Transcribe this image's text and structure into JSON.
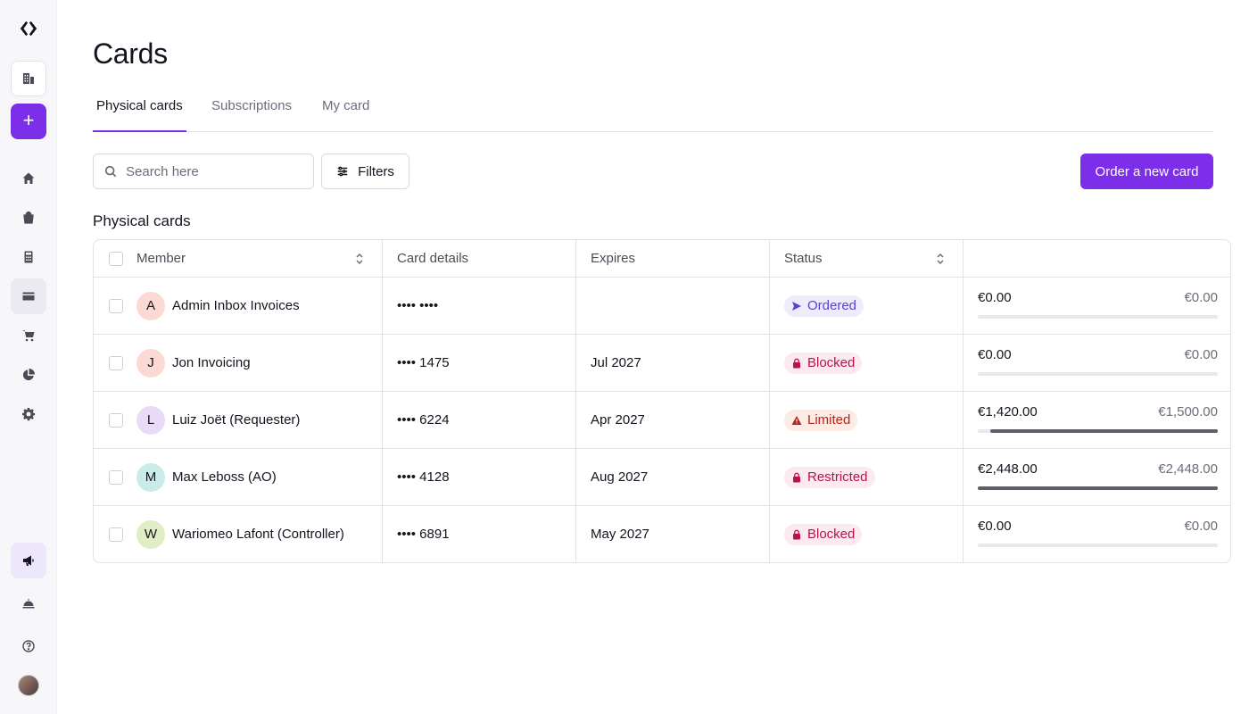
{
  "page": {
    "title": "Cards"
  },
  "tabs": [
    {
      "label": "Physical cards",
      "active": true
    },
    {
      "label": "Subscriptions",
      "active": false
    },
    {
      "label": "My card",
      "active": false
    }
  ],
  "toolbar": {
    "search_placeholder": "Search here",
    "filters_label": "Filters",
    "order_label": "Order a new card"
  },
  "section_title": "Physical cards",
  "table": {
    "columns": {
      "member": "Member",
      "card": "Card details",
      "expires": "Expires",
      "status": "Status"
    },
    "rows": [
      {
        "initial": "A",
        "avatar_bg": "#fcd9d3",
        "member": "Admin Inbox Invoices",
        "card": "•••• ••••",
        "expires": "",
        "status": "Ordered",
        "status_icon": "send-icon",
        "status_color": "#5b3fd1",
        "status_bg": "#eeebfb",
        "spent": "€0.00",
        "limit": "€0.00",
        "fraction": 0
      },
      {
        "initial": "J",
        "avatar_bg": "#fcd9d3",
        "member": "Jon Invoicing",
        "card": "•••• 1475",
        "expires": "Jul 2027",
        "status": "Blocked",
        "status_icon": "lock-icon",
        "status_color": "#b8124f",
        "status_bg": "#fbeaee",
        "spent": "€0.00",
        "limit": "€0.00",
        "fraction": 0
      },
      {
        "initial": "L",
        "avatar_bg": "#ead9f7",
        "member": "Luiz Joët (Requester)",
        "card": "•••• 6224",
        "expires": "Apr 2027",
        "status": "Limited",
        "status_icon": "warning-icon",
        "status_color": "#b42318",
        "status_bg": "#fdece6",
        "spent": "€1,420.00",
        "limit": "€1,500.00",
        "fraction": 0.947
      },
      {
        "initial": "M",
        "avatar_bg": "#c9eceb",
        "member": "Max Leboss (AO)",
        "card": "•••• 4128",
        "expires": "Aug 2027",
        "status": "Restricted",
        "status_icon": "lock-icon",
        "status_color": "#b8124f",
        "status_bg": "#fbeaee",
        "spent": "€2,448.00",
        "limit": "€2,448.00",
        "fraction": 1
      },
      {
        "initial": "W",
        "avatar_bg": "#e1edc4",
        "member": "Wariomeo Lafont (Controller)",
        "card": "•••• 6891",
        "expires": "May 2027",
        "status": "Blocked",
        "status_icon": "lock-icon",
        "status_color": "#b8124f",
        "status_bg": "#fbeaee",
        "spent": "€0.00",
        "limit": "€0.00",
        "fraction": 0
      }
    ]
  },
  "colors": {
    "accent": "#7c2ee8"
  }
}
